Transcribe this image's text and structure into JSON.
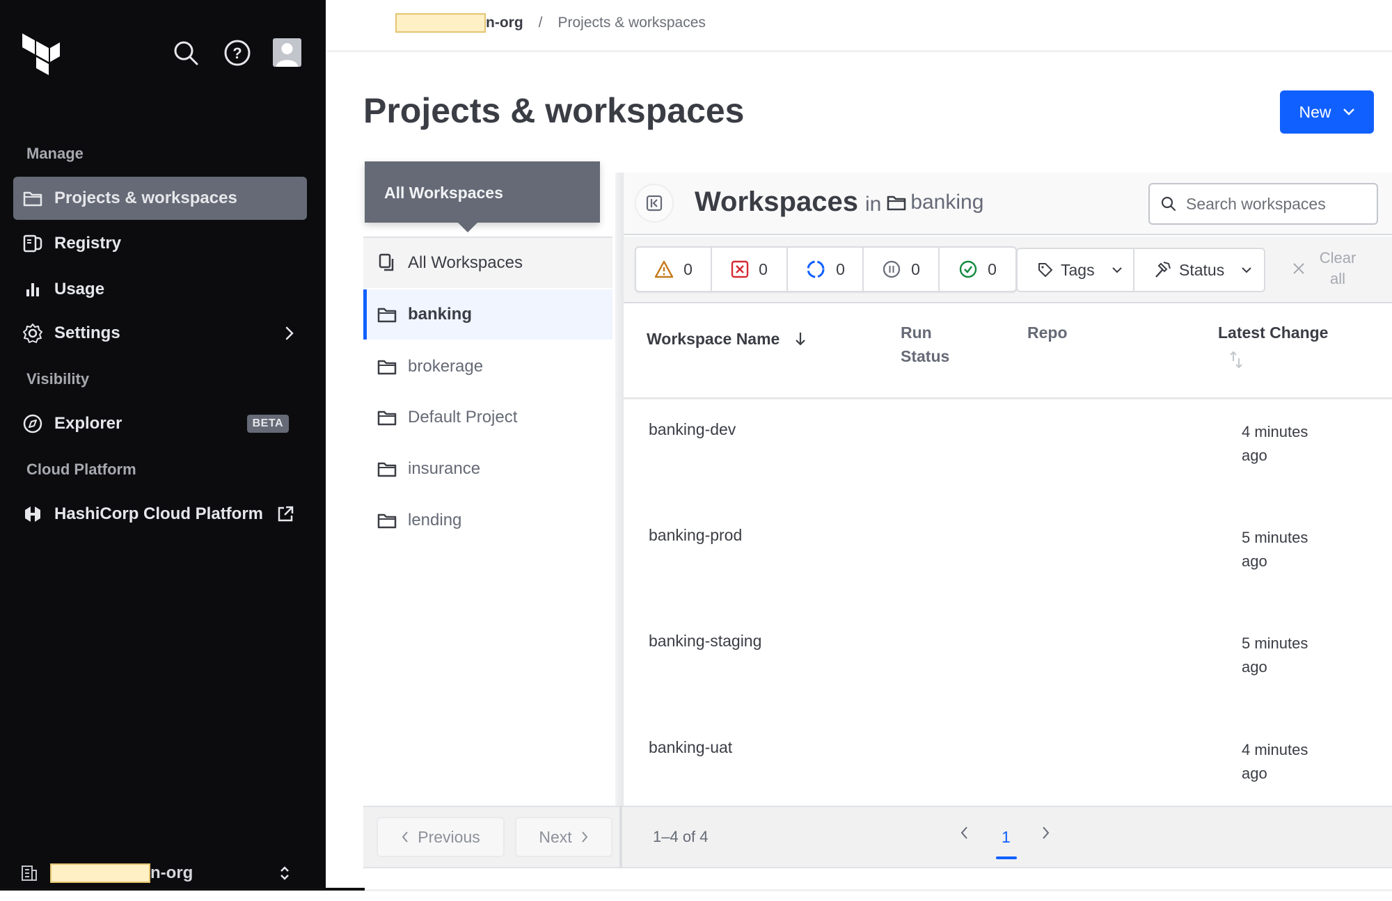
{
  "sidebar": {
    "sections": {
      "manage": "Manage",
      "visibility": "Visibility",
      "cloud_platform": "Cloud Platform"
    },
    "items": [
      {
        "label": "Projects & workspaces",
        "icon": "folder-icon",
        "active": true
      },
      {
        "label": "Registry",
        "icon": "registry-icon"
      },
      {
        "label": "Usage",
        "icon": "bar-chart-icon"
      },
      {
        "label": "Settings",
        "icon": "gear-icon",
        "trailing": "chevron-right-icon"
      },
      {
        "label": "Explorer",
        "icon": "compass-icon",
        "badge": "BETA"
      },
      {
        "label": "HashiCorp Cloud Platform",
        "icon": "hcp-icon",
        "trailing": "external-link-icon"
      }
    ],
    "org_suffix": "n-org"
  },
  "breadcrumb": {
    "org_suffix": "n-org",
    "separator": "/",
    "current": "Projects & workspaces"
  },
  "page": {
    "title": "Projects & workspaces",
    "new_button": "New"
  },
  "projects": {
    "tooltip": "All Workspaces",
    "items": [
      {
        "label": "All Workspaces",
        "icon": "copy-icon"
      },
      {
        "label": "banking",
        "icon": "folder-icon",
        "selected": true
      },
      {
        "label": "brokerage",
        "icon": "folder-icon"
      },
      {
        "label": "Default Project",
        "icon": "folder-icon"
      },
      {
        "label": "insurance",
        "icon": "folder-icon"
      },
      {
        "label": "lending",
        "icon": "folder-icon"
      }
    ],
    "previous": "Previous",
    "next": "Next"
  },
  "workspaces": {
    "title": "Workspaces",
    "in": "in",
    "project": "banking",
    "search_placeholder": "Search workspaces",
    "status_counts": [
      {
        "icon": "warning-icon",
        "count": "0",
        "color": "#c47a1d"
      },
      {
        "icon": "error-icon",
        "count": "0",
        "color": "#d62a35"
      },
      {
        "icon": "running-icon",
        "count": "0",
        "color": "#1060ff"
      },
      {
        "icon": "paused-icon",
        "count": "0",
        "color": "#656a76"
      },
      {
        "icon": "success-icon",
        "count": "0",
        "color": "#138a3f"
      }
    ],
    "tags_label": "Tags",
    "status_label": "Status",
    "clear_all": "Clear all",
    "columns": {
      "name": "Workspace Name",
      "run_status": "Run Status",
      "repo": "Repo",
      "latest_change": "Latest Change"
    },
    "rows": [
      {
        "name": "banking-dev",
        "run_status": "",
        "repo": "",
        "latest_change": "4 minutes ago"
      },
      {
        "name": "banking-prod",
        "run_status": "",
        "repo": "",
        "latest_change": "5 minutes ago"
      },
      {
        "name": "banking-staging",
        "run_status": "",
        "repo": "",
        "latest_change": "5 minutes ago"
      },
      {
        "name": "banking-uat",
        "run_status": "",
        "repo": "",
        "latest_change": "4 minutes ago"
      }
    ],
    "pagination": {
      "range": "1–4 of 4",
      "current_page": "1"
    }
  },
  "colors": {
    "accent": "#1060ff",
    "sidebar_bg": "#0c0c0e",
    "sidebar_active": "#656a76"
  }
}
